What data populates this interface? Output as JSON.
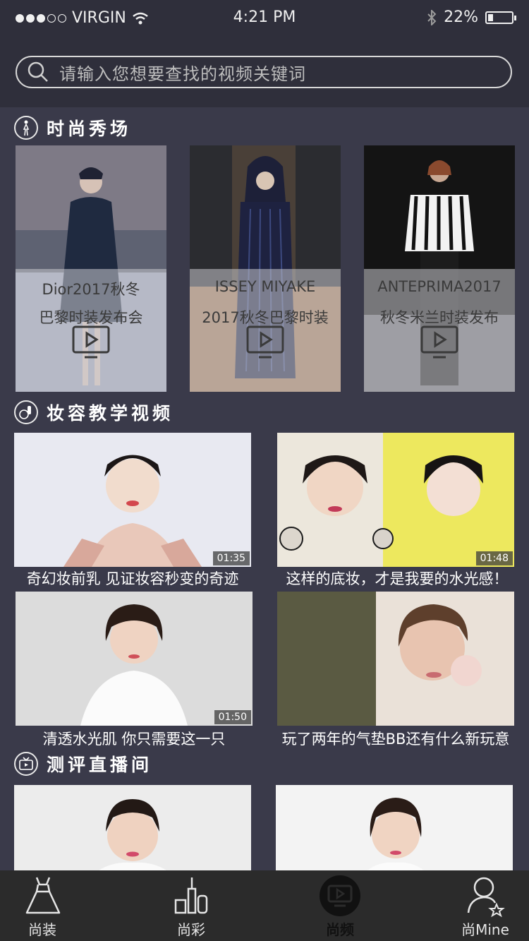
{
  "status": {
    "carrier": "VIRGIN",
    "time": "4:21 PM",
    "battery": "22%",
    "battery_level": 0.22
  },
  "search": {
    "placeholder": "请输入您想要查找的视频关键词"
  },
  "sections": {
    "fashion": {
      "title": "时尚秀场"
    },
    "makeup": {
      "title": "妆容教学视频"
    },
    "review": {
      "title": "测评直播间"
    }
  },
  "shows": [
    {
      "line1": "Dior2017秋冬",
      "line2": "巴黎时装发布会"
    },
    {
      "line1": "ISSEY MIYAKE",
      "line2": "2017秋冬巴黎时装"
    },
    {
      "line1": "ANTEPRIMA2017",
      "line2": "秋冬米兰时装发布"
    }
  ],
  "videos": [
    {
      "caption": "奇幻妆前乳 见证妆容秒变的奇迹",
      "duration": "01:35"
    },
    {
      "caption": "这样的底妆，才是我要的水光感！",
      "duration": "01:48"
    },
    {
      "caption": "清透水光肌 你只需要这一只",
      "duration": "01:50"
    },
    {
      "caption": "玩了两年的气垫BB还有什么新玩意",
      "duration": ""
    }
  ],
  "tabs": [
    {
      "label": "尚装"
    },
    {
      "label": "尚彩"
    },
    {
      "label": "尚频"
    },
    {
      "label": "尚Mine"
    }
  ],
  "colors": {
    "background": "#3a3a4a",
    "bar": "#2f2f3b",
    "tabbar": "#2b2b2b",
    "overlay": "#c8c8cd"
  }
}
